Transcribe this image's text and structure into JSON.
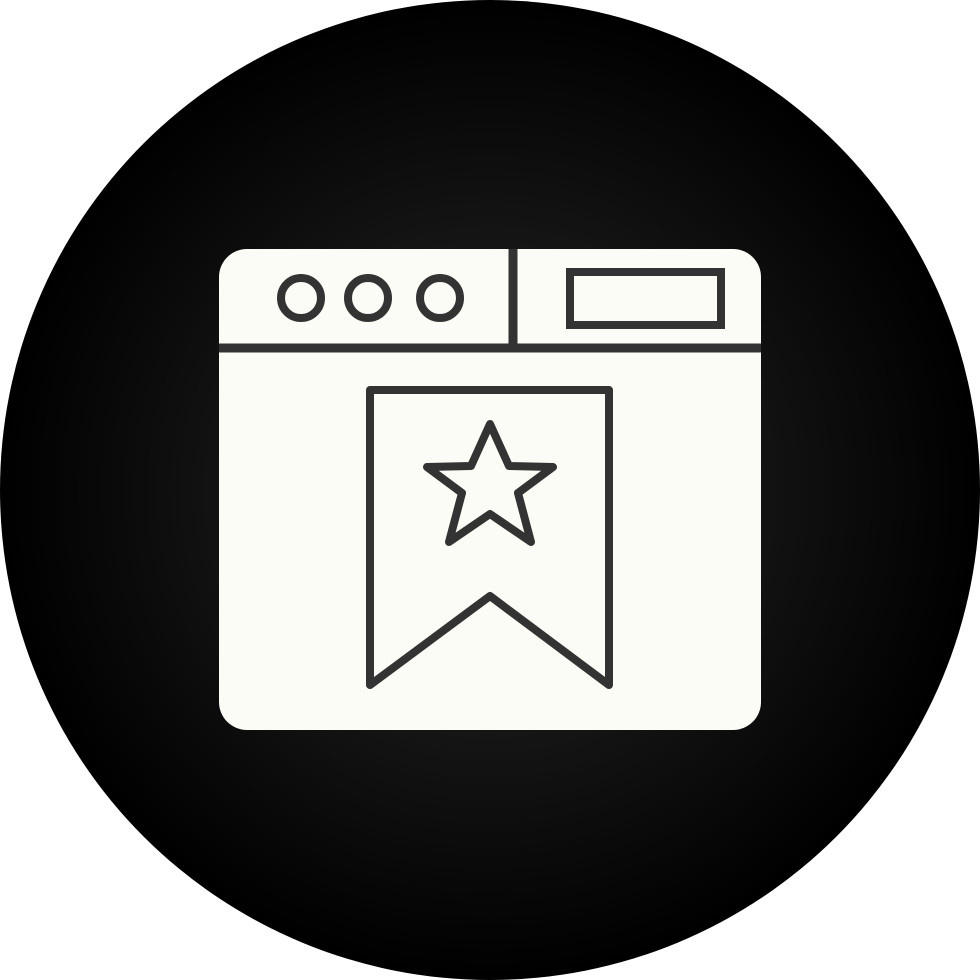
{
  "icon": {
    "name": "browser-bookmark-icon",
    "description_free": true,
    "parts": [
      "circle-badge",
      "browser-window-icon",
      "window-dots-icon",
      "address-bar-icon",
      "bookmark-ribbon-icon",
      "star-icon"
    ]
  },
  "colors": {
    "badge_center": "#2a2a2a",
    "badge_edge": "#000000",
    "fill": "#fbfcf5",
    "stroke": "#333333"
  }
}
